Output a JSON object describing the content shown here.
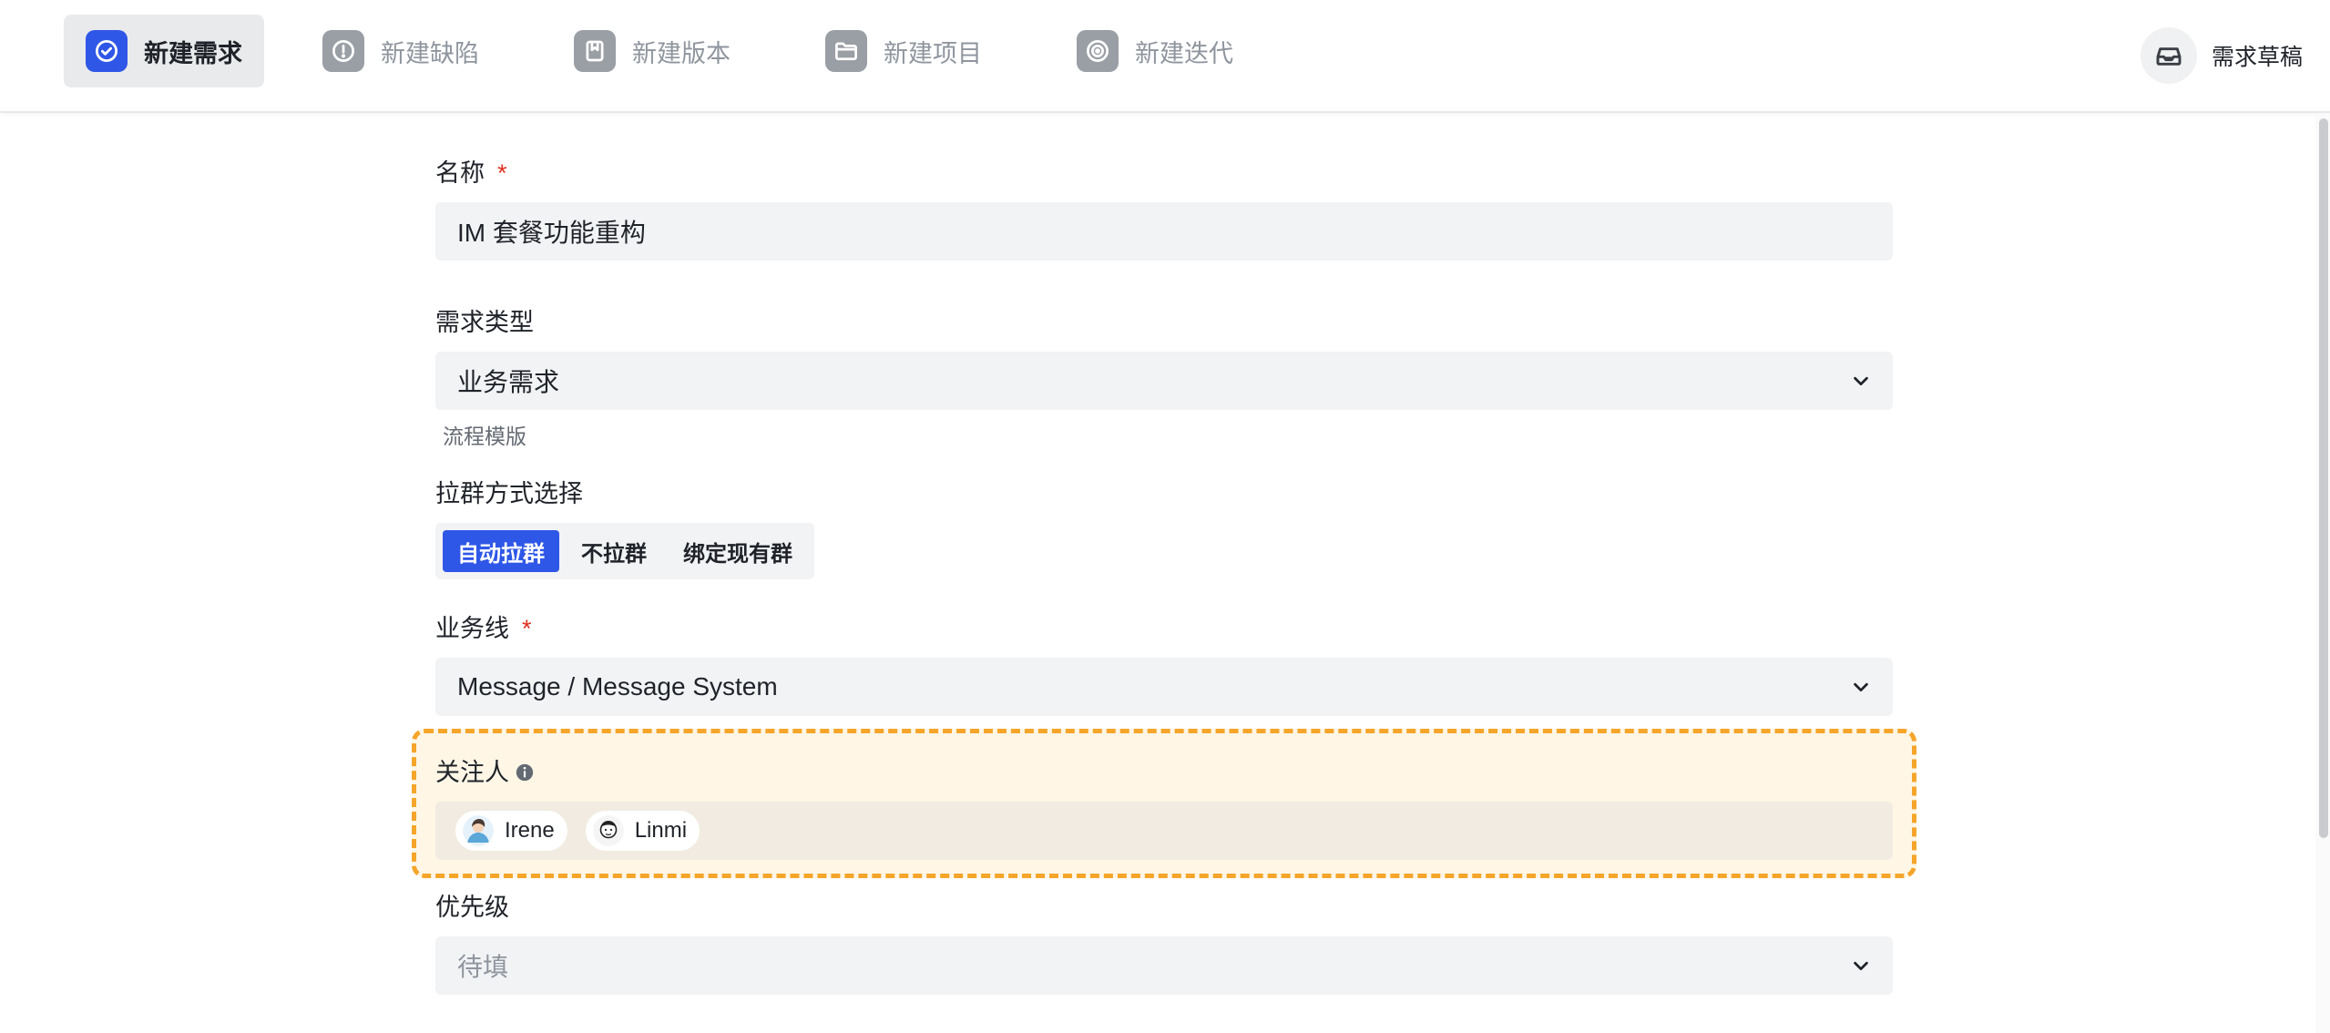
{
  "tabs": [
    {
      "label": "新建需求",
      "icon": "check-circle-icon",
      "active": true
    },
    {
      "label": "新建缺陷",
      "icon": "alert-circle-icon",
      "active": false
    },
    {
      "label": "新建版本",
      "icon": "bookmark-icon",
      "active": false
    },
    {
      "label": "新建项目",
      "icon": "folder-icon",
      "active": false
    },
    {
      "label": "新建迭代",
      "icon": "target-icon",
      "active": false
    }
  ],
  "drafts": {
    "label": "需求草稿",
    "icon": "inbox-icon"
  },
  "form": {
    "name": {
      "label": "名称",
      "required": "*",
      "value": "IM 套餐功能重构"
    },
    "req_type": {
      "label": "需求类型",
      "value": "业务需求",
      "hint": "流程模版"
    },
    "group_method": {
      "label": "拉群方式选择",
      "options": [
        "自动拉群",
        "不拉群",
        "绑定现有群"
      ],
      "selected": "自动拉群"
    },
    "business_line": {
      "label": "业务线",
      "required": "*",
      "value": "Message / Message System"
    },
    "watchers": {
      "label": "关注人",
      "people": [
        {
          "name": "Irene"
        },
        {
          "name": "Linmi"
        }
      ]
    },
    "priority": {
      "label": "优先级",
      "placeholder": "待填"
    }
  },
  "colors": {
    "accent": "#2f57e7",
    "required": "#e0301e",
    "highlight_border": "#f5a52a",
    "highlight_bg": "#fff6e6"
  }
}
